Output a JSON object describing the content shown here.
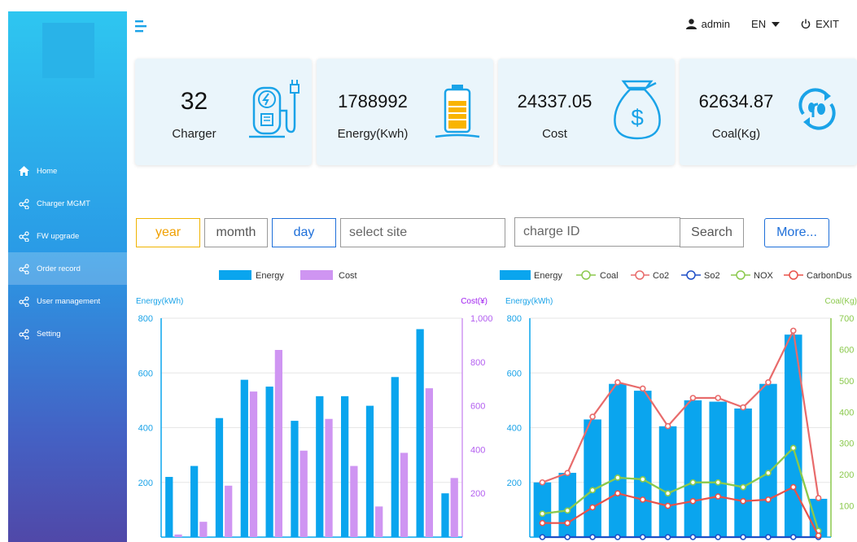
{
  "sidebar": {
    "items": [
      {
        "label": "Home",
        "icon": "home-icon",
        "active": false
      },
      {
        "label": "Charger MGMT",
        "icon": "share-icon",
        "active": false
      },
      {
        "label": "FW upgrade",
        "icon": "share-icon",
        "active": false
      },
      {
        "label": "Order record",
        "icon": "share-icon",
        "active": true
      },
      {
        "label": "User management",
        "icon": "share-icon",
        "active": false
      },
      {
        "label": "Setting",
        "icon": "share-icon",
        "active": false
      }
    ]
  },
  "topbar": {
    "user": "admin",
    "language": "EN",
    "exit_label": "EXIT"
  },
  "stats": [
    {
      "value": "32",
      "label": "Charger",
      "icon": "ev-charger-icon"
    },
    {
      "value": "1788992",
      "label": "Energy(Kwh)",
      "icon": "battery-icon"
    },
    {
      "value": "24337.05",
      "label": "Cost",
      "icon": "money-bag-icon"
    },
    {
      "value": "62634.87",
      "label": "Coal(Kg)",
      "icon": "eco-recycle-icon"
    }
  ],
  "filters": {
    "year_label": "year",
    "month_label": "momth",
    "day_label": "day",
    "site_placeholder": "select site",
    "charge_id_placeholder": "charge ID",
    "search_label": "Search",
    "more_label": "More..."
  },
  "colors": {
    "energy": "#0aa5ee",
    "cost": "#cf95f2",
    "coal": "#8bc94d",
    "co2": "#e86b6b",
    "so2": "#1e4fc7",
    "nox": "#8bc94d",
    "carbondust": "#e8524a",
    "year_border": "#f0b400",
    "day_border": "#1e6fd9"
  },
  "chart_data": [
    {
      "type": "bar",
      "legend": [
        "Energy",
        "Cost"
      ],
      "ylabel_left": "Energy(kWh)",
      "ylabel_right": "Cost(¥)",
      "left_ticks": [
        "200",
        "400",
        "600",
        "800"
      ],
      "right_ticks": [
        "200",
        "400",
        "600",
        "800",
        "1,000"
      ],
      "ylim_left": [
        0,
        800
      ],
      "ylim_right": [
        0,
        1000
      ],
      "series": [
        {
          "name": "Energy",
          "axis": "left",
          "values": [
            220,
            260,
            435,
            575,
            550,
            425,
            515,
            515,
            480,
            585,
            760,
            160
          ]
        },
        {
          "name": "Cost",
          "axis": "right",
          "values": [
            12,
            70,
            235,
            665,
            855,
            395,
            540,
            325,
            140,
            385,
            680,
            270
          ]
        }
      ]
    },
    {
      "type": "bar",
      "legend": [
        "Energy",
        "Coal",
        "Co2",
        "So2",
        "NOX",
        "CarbonDus"
      ],
      "ylabel_left": "Energy(kWh)",
      "ylabel_right": "Coal(Kg)",
      "left_ticks": [
        "200",
        "400",
        "600",
        "800"
      ],
      "right_ticks": [
        "100",
        "200",
        "300",
        "400",
        "500",
        "600",
        "700"
      ],
      "ylim_left": [
        0,
        800
      ],
      "ylim_right": [
        0,
        700
      ],
      "series": [
        {
          "name": "Energy",
          "axis": "left",
          "values": [
            200,
            235,
            430,
            560,
            535,
            405,
            500,
            495,
            470,
            560,
            740,
            140
          ]
        },
        {
          "name": "Coal",
          "axis": "right",
          "values": [
            75,
            85,
            150,
            190,
            185,
            140,
            175,
            175,
            160,
            205,
            285,
            20
          ]
        },
        {
          "name": "Co2",
          "axis": "right",
          "values": [
            175,
            205,
            385,
            495,
            475,
            355,
            445,
            445,
            415,
            495,
            660,
            125
          ]
        },
        {
          "name": "So2",
          "axis": "right",
          "values": [
            0,
            0,
            0,
            0,
            0,
            0,
            0,
            0,
            0,
            0,
            0,
            0
          ]
        },
        {
          "name": "NOX",
          "axis": "right",
          "values": [
            75,
            85,
            150,
            190,
            185,
            140,
            175,
            175,
            160,
            205,
            285,
            20
          ]
        },
        {
          "name": "CarbonDus",
          "axis": "right",
          "values": [
            45,
            45,
            95,
            140,
            120,
            100,
            115,
            130,
            115,
            120,
            160,
            5
          ]
        }
      ]
    }
  ]
}
